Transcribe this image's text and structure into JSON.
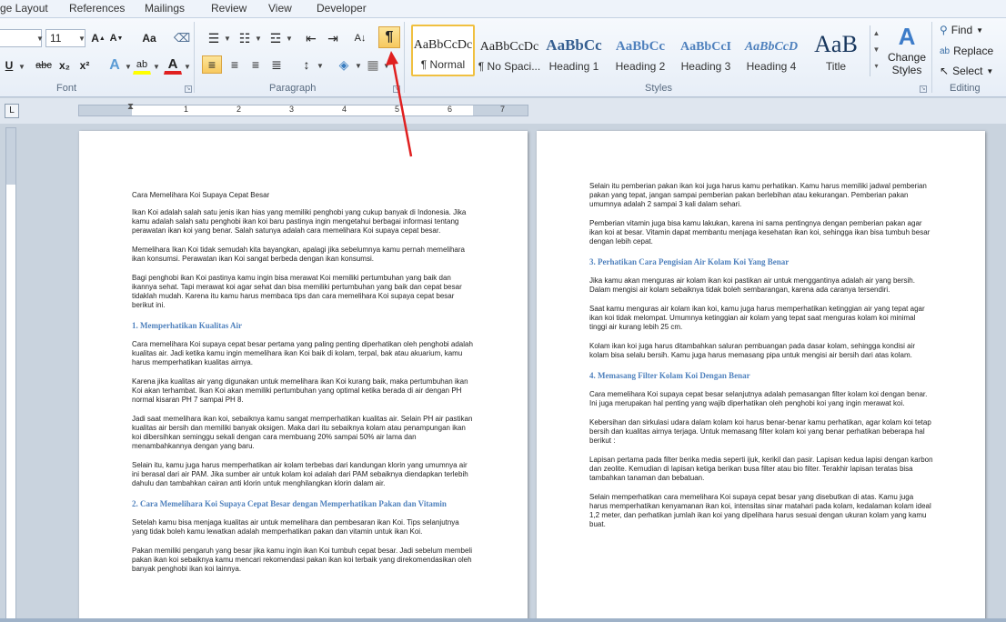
{
  "tabs": [
    "ge Layout",
    "References",
    "Mailings",
    "Review",
    "View",
    "Developer"
  ],
  "font_group": {
    "size": "11",
    "label": "Font",
    "change_case": "Aa",
    "bold_hidden": "U",
    "strike": "abc",
    "subscript": "x₂",
    "superscript": "x²",
    "text_effects": "A",
    "highlight": "ab",
    "font_color": "A",
    "grow": "A",
    "shrink": "A"
  },
  "paragraph_group": {
    "label": "Paragraph",
    "pilcrow": "¶",
    "sort": "A↓"
  },
  "styles_group": {
    "label": "Styles",
    "styles": [
      {
        "preview": "AaBbCcDc",
        "name": "¶ Normal"
      },
      {
        "preview": "AaBbCcDc",
        "name": "¶ No Spaci..."
      },
      {
        "preview": "AaBbCc",
        "name": "Heading 1"
      },
      {
        "preview": "AaBbCc",
        "name": "Heading 2"
      },
      {
        "preview": "AaBbCcI",
        "name": "Heading 3"
      },
      {
        "preview": "AaBbCcD",
        "name": "Heading 4"
      },
      {
        "preview": "AaB",
        "name": "Title"
      }
    ],
    "change_styles_line1": "Change",
    "change_styles_line2": "Styles"
  },
  "editing_group": {
    "label": "Editing",
    "find": "Find",
    "replace": "Replace",
    "select": "Select"
  },
  "ruler_numbers": [
    "1",
    "2",
    "3",
    "4",
    "5",
    "6",
    "7"
  ],
  "tab_stop": "L",
  "page1": {
    "title": "Cara Memelihara Koi Supaya Cepat Besar",
    "p1": "Ikan Koi adalah salah satu jenis ikan hias yang memiliki penghobi yang cukup banyak di Indonesia. Jika kamu adalah salah satu penghobi ikan koi baru pastinya ingin mengetahui berbagai informasi tentang perawatan ikan koi yang benar. Salah satunya adalah cara memelihara Koi supaya cepat besar.",
    "p2": "Memelihara Ikan Koi tidak semudah kita bayangkan, apalagi jika sebelumnya kamu pernah memelihara ikan konsumsi. Perawatan ikan Koi sangat berbeda dengan ikan konsumsi.",
    "p3": "Bagi penghobi ikan Koi pastinya kamu ingin bisa merawat Koi memiliki pertumbuhan yang baik dan ikannya sehat. Tapi merawat koi agar sehat dan bisa memiliki pertumbuhan yang baik dan cepat besar tidaklah mudah. Karena itu kamu harus membaca tips dan cara memelihara Koi supaya cepat besar berikut ini.",
    "h1": "1. Memperhatikan  Kualitas Air",
    "p4": "Cara memelihara Koi supaya cepat besar pertama yang paling penting diperhatikan oleh penghobi adalah kualitas air. Jadi ketika kamu ingin memelihara ikan Koi baik di kolam, terpal, bak atau akuarium, kamu harus memperhatikan kualitas airnya.",
    "p5": "Karena jika kualitas air yang digunakan untuk memelihara ikan Koi kurang baik, maka pertumbuhan ikan Koi akan terhambat. Ikan Koi akan memiliki pertumbuhan yang optimal ketika berada di air dengan PH normal kisaran PH 7 sampai PH 8.",
    "p6": "Jadi saat memelihara ikan koi, sebaiknya kamu sangat memperhatikan kualitas air. Selain PH air pastikan kualitas air bersih dan memiliki banyak oksigen. Maka dari itu sebaiknya kolam atau penampungan ikan koi dibersihkan seminggu sekali dengan cara membuang 20% sampai 50% air lama dan menambahkannya dengan yang baru.",
    "p7": "Selain itu, kamu juga harus memperhatikan air kolam terbebas dari kandungan klorin yang umumnya air ini berasal dari air PAM. Jika sumber air untuk kolam koi adalah dari PAM sebaiknya diendapkan terlebih dahulu dan tambahkan cairan anti klorin untuk menghilangkan klorin dalam air.",
    "h2": "2. Cara Memelihara  Koi Supaya  Cepat  Besar dengan  Memperhatikan  Pakan dan Vitamin",
    "p8": "Setelah kamu bisa menjaga kualitas air untuk memelihara dan pembesaran ikan Koi. Tips selanjutnya yang tidak boleh kamu lewatkan adalah memperhatikan pakan dan vitamin untuk ikan Koi.",
    "p9": "Pakan memiliki pengaruh yang besar jika kamu ingin ikan Koi tumbuh cepat besar. Jadi sebelum membeli pakan ikan koi sebaiknya kamu mencari rekomendasi pakan ikan koi terbaik yang direkomendasikan oleh banyak penghobi ikan koi lainnya."
  },
  "page2": {
    "p1": "Selain itu pemberian pakan ikan koi juga harus kamu perhatikan. Kamu harus memiliki jadwal pemberian pakan yang tepat, jangan sampai pemberian pakan berlebihan atau kekurangan. Pemberian pakan umumnya adalah 2 sampai 3 kali dalam sehari.",
    "p2": "Pemberian vitamin juga bisa kamu lakukan, karena ini sama pentingnya dengan pemberian pakan agar ikan koi at besar. Vitamin dapat membantu menjaga kesehatan ikan koi, sehingga ikan bisa tumbuh besar dengan lebih cepat.",
    "h3": "3. Perhatikan  Cara Pengisian  Air Kolam Koi Yang Benar",
    "p3": "Jika kamu akan menguras air kolam ikan koi pastikan air untuk menggantinya adalah air yang bersih. Dalam mengisi air kolam sebaiknya tidak boleh sembarangan, karena ada caranya tersendiri.",
    "p4": "Saat kamu menguras air kolam ikan koi, kamu juga harus memperhatikan ketinggian air yang tepat agar ikan koi tidak melompat. Umumnya ketinggian air kolam yang tepat saat menguras kolam koi minimal tinggi air kurang lebih 25 cm.",
    "p5": "Kolam ikan koi juga harus ditambahkan saluran pembuangan pada dasar kolam, sehingga kondisi air kolam bisa selalu bersih. Kamu juga harus memasang pipa untuk mengisi air bersih dari atas kolam.",
    "h4": "4. Memasang  Filter Kolam  Koi Dengan  Benar",
    "p6": "Cara memelihara Koi supaya cepat besar selanjutnya adalah pemasangan filter kolam koi dengan benar. Ini juga merupakan hal penting yang wajib diperhatikan oleh penghobi koi yang ingin merawat koi.",
    "p7": "Kebersihan dan sirkulasi udara dalam kolam koi harus benar-benar kamu perhatikan, agar kolam koi tetap bersih dan kualitas airnya terjaga. Untuk memasang filter kolam koi yang benar perhatikan beberapa hal berikut :",
    "p8": "Lapisan pertama pada filter berika media seperti ijuk, kerikil dan pasir. Lapisan kedua lapisi dengan karbon dan zeolite. Kemudian di lapisan ketiga berikan busa filter atau bio filter. Terakhir lapisan teratas bisa tambahkan tanaman dan bebatuan.",
    "p9": "Selain memperhatikan cara memelihara Koi supaya cepat besar yang disebutkan di atas. Kamu juga harus memperhatikan kenyamanan ikan koi, intensitas sinar matahari pada kolam, kedalaman kolam ideal 1,2 meter, dan perhatikan jumlah ikan koi yang dipelihara harus sesuai dengan ukuran kolam yang kamu buat."
  },
  "colors": {
    "accent": "#e02020",
    "heading": "#4f81bd",
    "selected_button": "#f7c95f"
  }
}
